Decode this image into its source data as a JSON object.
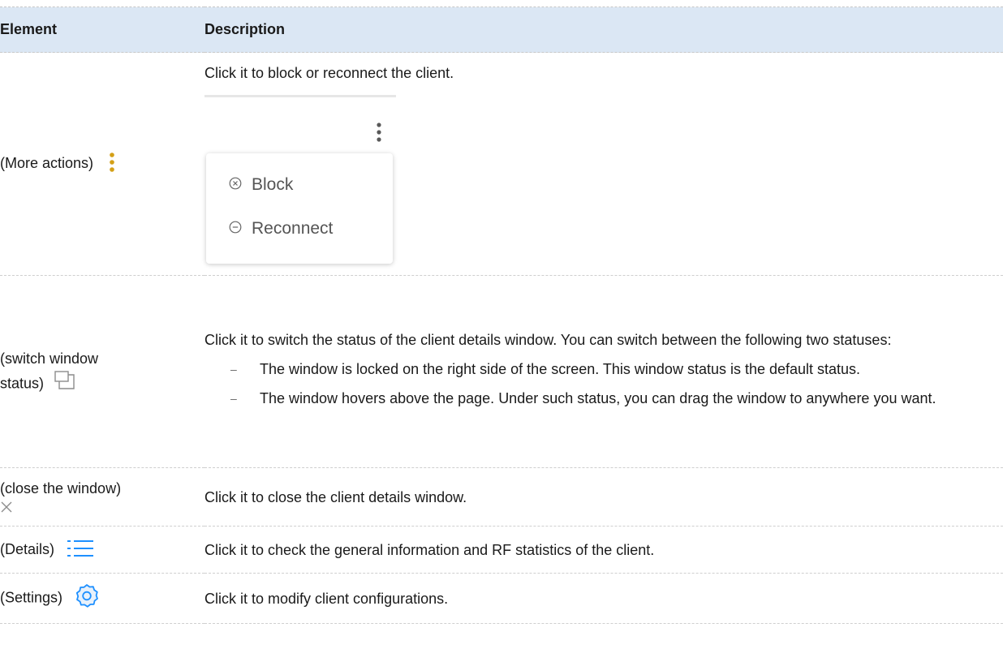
{
  "header": {
    "col_element": "Element",
    "col_description": "Description"
  },
  "rows": {
    "more_actions": {
      "label": "(More actions)",
      "icon": "kebab-icon",
      "description": "Click it to block or reconnect the client.",
      "menu": [
        {
          "icon": "circle-x-icon",
          "label": "Block"
        },
        {
          "icon": "circle-minus-icon",
          "label": "Reconnect"
        }
      ]
    },
    "switch_status": {
      "label_line1": "(switch window",
      "label_line2": "status)",
      "icon": "window-restore-icon",
      "description": "Click it to switch the status of the client details window. You can switch between the following two statuses:",
      "statuses": [
        "The window is locked on the right side of the screen. This window status is the default status.",
        "The window hovers above the page. Under such status, you can drag the window to anywhere you want."
      ]
    },
    "close_window": {
      "label": "(close the window)",
      "icon": "close-icon",
      "description": "Click it to close the client details window."
    },
    "details": {
      "label": "(Details)",
      "icon": "list-icon",
      "description": "Click it to check the general information and RF statistics of the client."
    },
    "settings": {
      "label": "(Settings)",
      "icon": "gear-icon",
      "description": "Click it to modify client configurations."
    }
  },
  "colors": {
    "header_bg": "#dbe7f4",
    "accent_blue": "#1e90ff",
    "icon_gray": "#8c8c8c"
  }
}
